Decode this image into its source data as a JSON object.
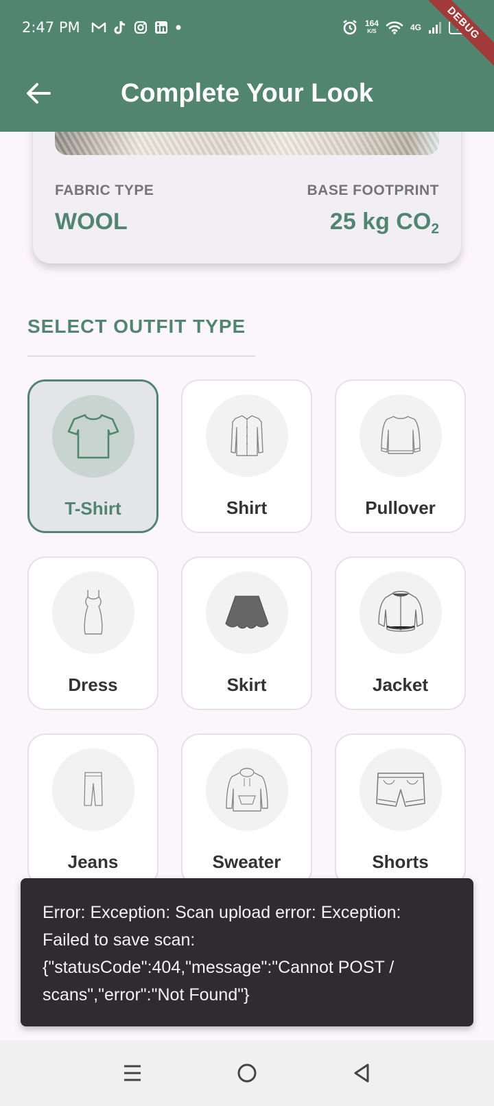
{
  "status_bar": {
    "time": "2:47 PM",
    "notification_icons": [
      "gmail-icon",
      "tiktok-icon",
      "instagram-icon",
      "linkedin-icon",
      "dot-icon"
    ],
    "speed_value": "164",
    "speed_unit": "K/S",
    "network": "4G",
    "battery": "74",
    "debug_banner": "DEBUG"
  },
  "app_bar": {
    "title": "Complete Your Look",
    "back_icon": "arrow-back-icon"
  },
  "fabric_card": {
    "fabric_type_label": "FABRIC TYPE",
    "fabric_type_value": "WOOL",
    "footprint_label": "BASE FOOTPRINT",
    "footprint_value": "25 kg CO",
    "footprint_subscript": "2"
  },
  "outfit_section": {
    "title": "SELECT OUTFIT TYPE",
    "selected": "T-Shirt",
    "items": [
      {
        "label": "T-Shirt",
        "icon": "tshirt-icon"
      },
      {
        "label": "Shirt",
        "icon": "shirt-icon"
      },
      {
        "label": "Pullover",
        "icon": "pullover-icon"
      },
      {
        "label": "Dress",
        "icon": "dress-icon"
      },
      {
        "label": "Skirt",
        "icon": "skirt-icon"
      },
      {
        "label": "Jacket",
        "icon": "jacket-icon"
      },
      {
        "label": "Jeans",
        "icon": "jeans-icon"
      },
      {
        "label": "Sweater",
        "icon": "hoodie-icon"
      },
      {
        "label": "Shorts",
        "icon": "shorts-icon"
      }
    ]
  },
  "snackbar": {
    "message": "Error: Exception: Scan upload error: Exception:\nFailed to save scan:\n{\"statusCode\":404,\"message\":\"Cannot POST /\nscans\",\"error\":\"Not Found\"}"
  },
  "nav_bar": {
    "icons": [
      "recents-icon",
      "home-icon",
      "back-icon"
    ]
  },
  "colors": {
    "primary": "#528570",
    "background": "#fbf6fb",
    "snackbar": "#2f2c31"
  }
}
